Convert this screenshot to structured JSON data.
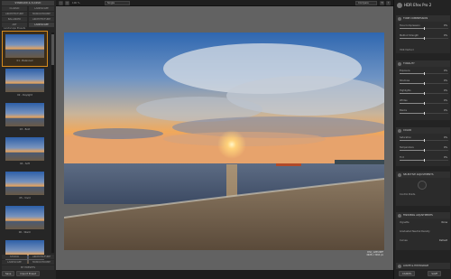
{
  "left_panel": {
    "category_tabs": [
      [
        "STANDARD & CLASSIC"
      ],
      [
        "CLASSIC",
        "LANDSCAPE"
      ],
      [
        "ARCHITECTURE",
        "MONOCHROME"
      ],
      [
        "BALANCED",
        "ARCHITECTURE"
      ],
      [
        "ART",
        "LANDSCAPE"
      ]
    ],
    "strip_title": "Landscape Presets",
    "presets": [
      {
        "label": "01 - Balanced"
      },
      {
        "label": "02 - Daylight"
      },
      {
        "label": "03 - Bold"
      },
      {
        "label": "04 - Soft"
      },
      {
        "label": "05 - Vivid"
      },
      {
        "label": "06 - Warm"
      },
      {
        "label": "07 - Cool"
      }
    ],
    "bottom_tabs": [
      [
        "STUDIO",
        "ARCHITECTURE"
      ],
      [
        "LANDSCAPE",
        "MONOCHROME"
      ],
      [
        "MY PRESETS"
      ]
    ],
    "buttons": {
      "save": "Save",
      "import": "Import Preset"
    }
  },
  "topbar": {
    "zoom": "100 %",
    "view_mode": "Single",
    "compare": "Compare",
    "history": "History"
  },
  "canvas": {
    "caption_line1": "DSC_1283.NEF",
    "caption_line2": "4928 x 3264 px"
  },
  "right_panel": {
    "app_name": "HDR Efex Pro 2",
    "sections": {
      "tone": "TONE COMPRESSION",
      "hdr": "HDR Method",
      "tonality": "TONALITY",
      "color": "COLOR",
      "selective": "SELECTIVE ADJUSTMENTS",
      "finishing": "FINISHING ADJUSTMENTS",
      "loupe": "LOUPE & HISTOGRAM"
    },
    "tone_rows": [
      {
        "label": "Tone Compression",
        "value": "0%",
        "pct": 0.5
      },
      {
        "label": "Method Strength",
        "value": "0%",
        "pct": 0.5
      }
    ],
    "tonality_rows": [
      {
        "label": "Exposure",
        "value": "0%",
        "pct": 0.5
      },
      {
        "label": "Shadows",
        "value": "0%",
        "pct": 0.5
      },
      {
        "label": "Highlights",
        "value": "0%",
        "pct": 0.5
      },
      {
        "label": "Whites",
        "value": "0%",
        "pct": 0.5
      },
      {
        "label": "Blacks",
        "value": "0%",
        "pct": 0.5
      }
    ],
    "color_rows": [
      {
        "label": "Saturation",
        "value": "0%",
        "pct": 0.5
      },
      {
        "label": "Temperature",
        "value": "0%",
        "pct": 0.5
      },
      {
        "label": "Tint",
        "value": "0%",
        "pct": 0.5
      }
    ],
    "selective": {
      "add_label": "Control Points"
    },
    "finishing": [
      {
        "label": "Vignette",
        "value": "None"
      },
      {
        "label": "Graduated Neutral Density",
        "value": ""
      },
      {
        "label": "Curves",
        "value": "Default"
      }
    ],
    "buttons": {
      "cancel": "CANCEL",
      "save": "SAVE"
    }
  }
}
